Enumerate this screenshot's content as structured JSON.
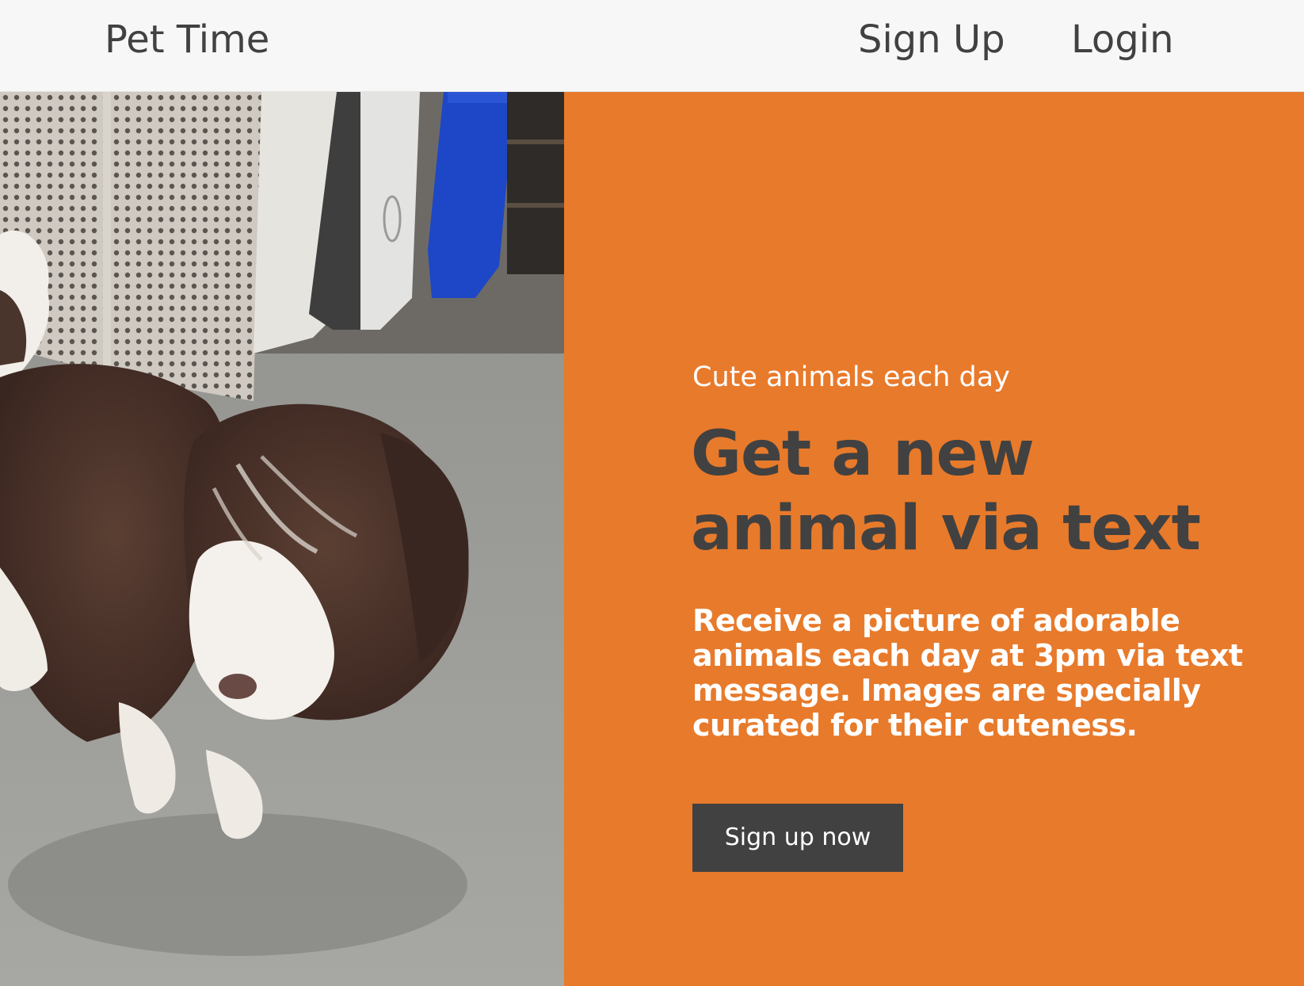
{
  "nav": {
    "brand": "Pet Time",
    "signup_label": "Sign Up",
    "login_label": "Login"
  },
  "hero": {
    "eyebrow": "Cute animals each day",
    "headline": "Get a new animal via text",
    "description": "Receive a picture of adorable animals each day at 3pm via text message. Images are specially curated for their cuteness.",
    "cta_label": "Sign up now"
  },
  "colors": {
    "accent": "#e87a2b",
    "dark": "#414141",
    "nav_background": "#f7f7f7"
  }
}
